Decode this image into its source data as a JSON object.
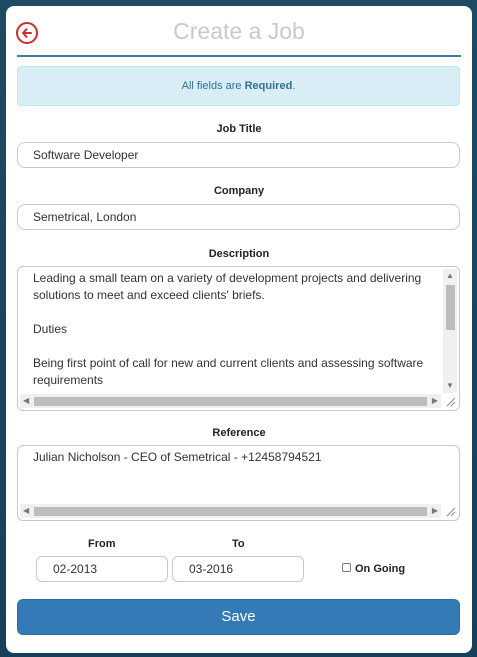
{
  "header": {
    "title": "Create a Job",
    "back_icon": "circle-arrow-left-icon",
    "accent": "#c9302c"
  },
  "alert": {
    "prefix": "All fields are ",
    "emphasis": "Required",
    "suffix": "."
  },
  "form": {
    "job_title": {
      "label": "Job Title",
      "value": "Software Developer"
    },
    "company": {
      "label": "Company",
      "value": "Semetrical, London"
    },
    "description": {
      "label": "Description",
      "value": "Leading a small team on a variety of development projects and delivering\nsolutions to meet and exceed clients' briefs.\n\nDuties\n\nBeing first point of call for new and current clients and assessing software\nrequirements"
    },
    "reference": {
      "label": "Reference",
      "value": "Julian Nicholson - CEO of Semetrical - +12458794521"
    },
    "from": {
      "label": "From",
      "value": "02-2013"
    },
    "to": {
      "label": "To",
      "value": "03-2016"
    },
    "ongoing": {
      "label": "On Going",
      "checked": false
    }
  },
  "actions": {
    "save_label": "Save",
    "save_color": "#337ab7"
  }
}
